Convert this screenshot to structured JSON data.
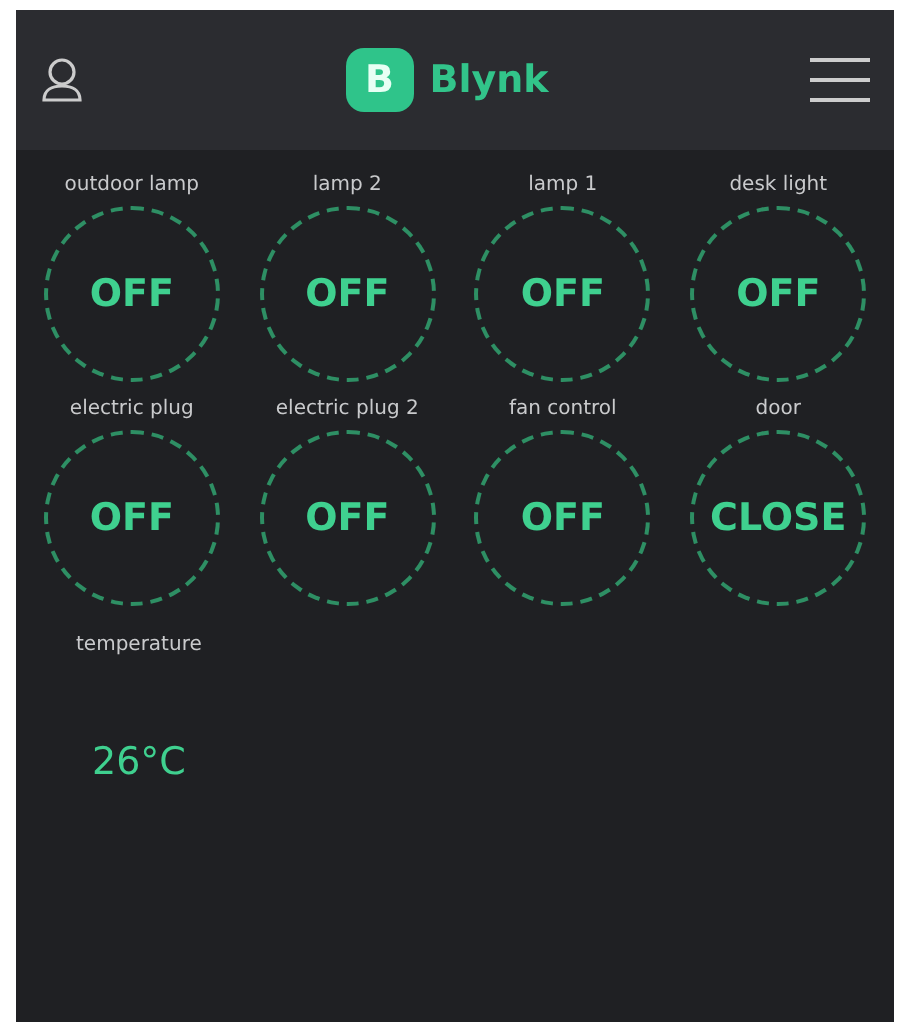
{
  "header": {
    "logo_letter": "B",
    "title": "Blynk"
  },
  "switches": [
    {
      "label": "outdoor lamp",
      "value": "OFF",
      "on": false
    },
    {
      "label": "lamp 2",
      "value": "OFF",
      "on": false
    },
    {
      "label": "lamp 1",
      "value": "OFF",
      "on": false
    },
    {
      "label": "desk light",
      "value": "OFF",
      "on": false
    },
    {
      "label": "electric plug",
      "value": "OFF",
      "on": false
    },
    {
      "label": "electric plug 2",
      "value": "OFF",
      "on": false
    },
    {
      "label": "fan control",
      "value": "OFF",
      "on": false
    },
    {
      "label": "door",
      "value": "CLOSE",
      "on": false
    }
  ],
  "display": {
    "label": "temperature",
    "value": "26°C"
  }
}
